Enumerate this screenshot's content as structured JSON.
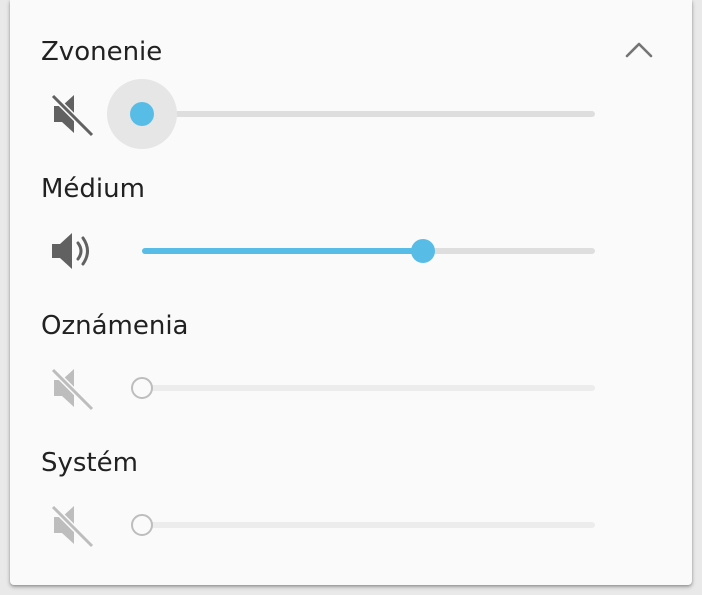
{
  "panel": {
    "collapse_icon": "chevron-up-icon"
  },
  "rows": [
    {
      "label": "Zvonenie",
      "icon": "volume-muted-icon",
      "level": 0,
      "active": true,
      "focused": true
    },
    {
      "label": "Médium",
      "icon": "volume-up-icon",
      "level": 0.62,
      "active": true,
      "focused": false
    },
    {
      "label": "Oznámenia",
      "icon": "volume-muted-icon",
      "level": 0,
      "active": false,
      "focused": false
    },
    {
      "label": "Systém",
      "icon": "volume-muted-icon",
      "level": 0,
      "active": false,
      "focused": false
    }
  ],
  "colors": {
    "accent": "#58bde6",
    "icon_active": "#616161",
    "icon_disabled": "#bdbdbd",
    "track": "#dedede"
  }
}
